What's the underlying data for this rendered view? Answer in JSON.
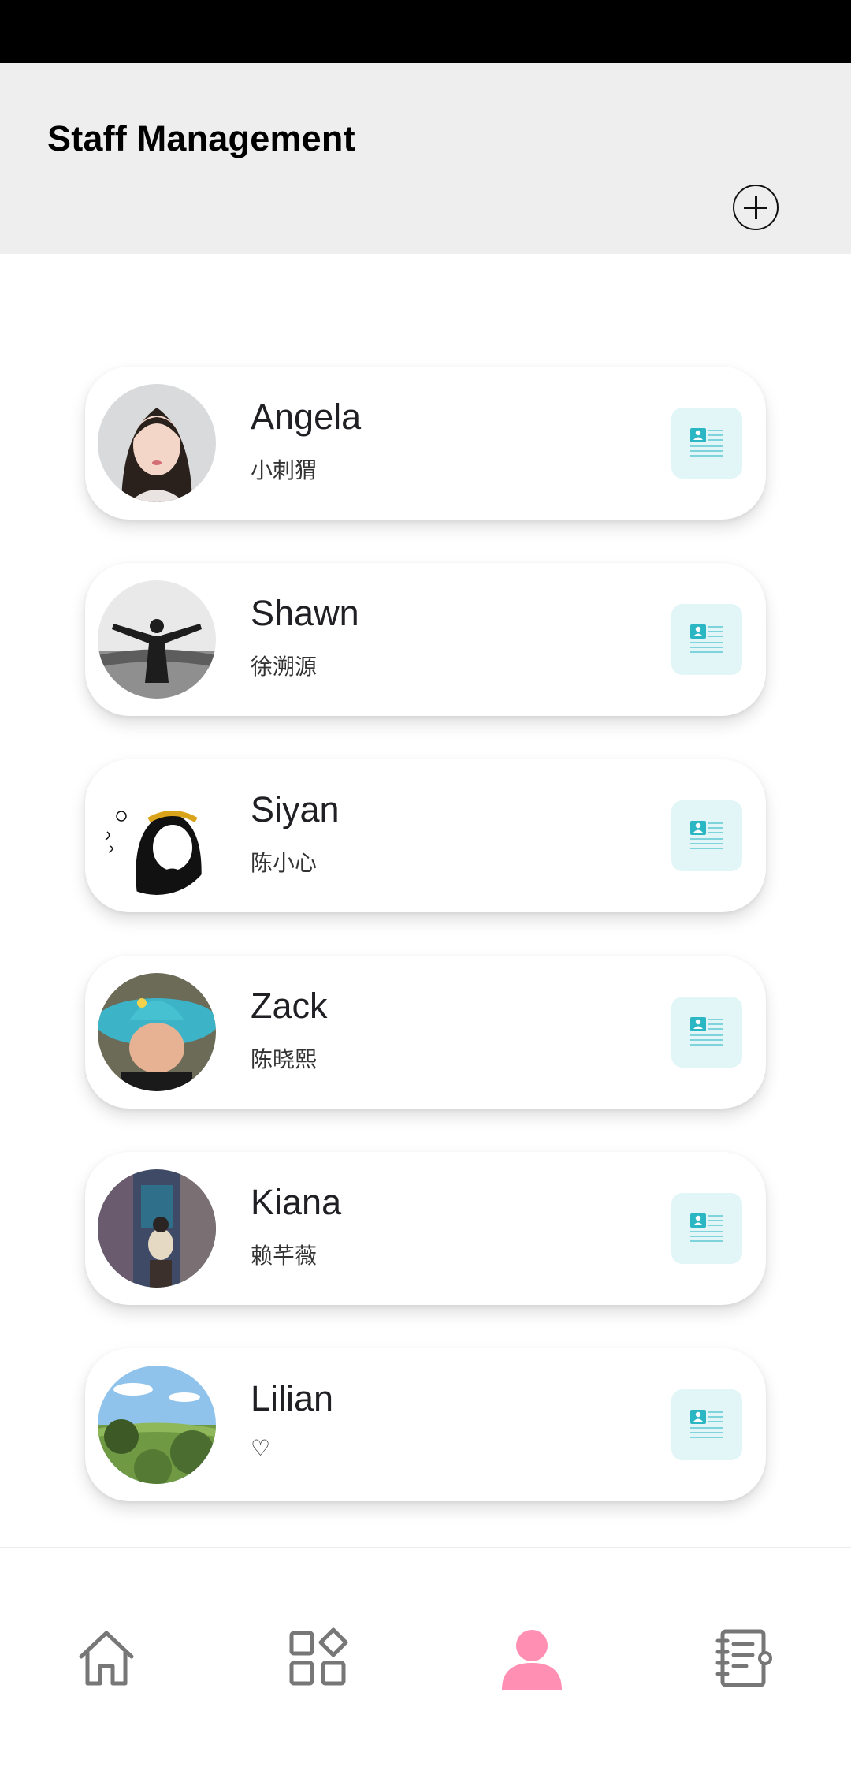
{
  "header": {
    "title": "Staff Management"
  },
  "staff": [
    {
      "name": "Angela",
      "subtitle": "小刺猬"
    },
    {
      "name": "Shawn",
      "subtitle": "徐溯源"
    },
    {
      "name": "Siyan",
      "subtitle": "陈小心"
    },
    {
      "name": "Zack",
      "subtitle": "陈晓熙"
    },
    {
      "name": "Kiana",
      "subtitle": "赖芊薇"
    },
    {
      "name": "Lilian",
      "subtitle": "♡"
    }
  ],
  "bottom_nav": {
    "items": [
      {
        "icon": "home-icon",
        "active": false
      },
      {
        "icon": "apps-grid-icon",
        "active": false
      },
      {
        "icon": "person-icon",
        "active": true
      },
      {
        "icon": "notebook-icon",
        "active": false
      }
    ]
  },
  "colors": {
    "accent": "#ff8fb3",
    "profile_button_bg": "#e2f6f8",
    "profile_icon": "#2bb6c4",
    "header_bg": "#eeeeee"
  }
}
